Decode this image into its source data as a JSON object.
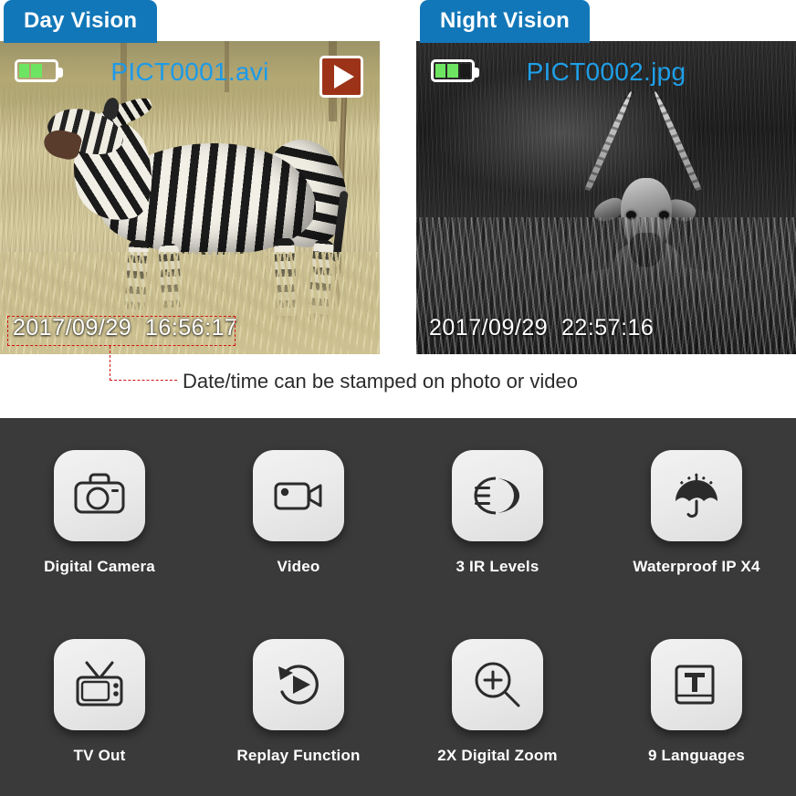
{
  "panels": [
    {
      "tab_label": "Day Vision",
      "file_name": "PICT0001.avi",
      "timestamp": "2017/09/29  16:56:17",
      "battery_icon": "battery-icon",
      "play_icon": "play-icon",
      "subject": "zebra"
    },
    {
      "tab_label": "Night Vision",
      "file_name": "PICT0002.jpg",
      "timestamp": "2017/09/29  22:57:16",
      "battery_icon": "battery-icon",
      "subject": "antelope"
    }
  ],
  "annotation": {
    "caption": "Date/time can be stamped on photo or video",
    "line_color": "#d01414"
  },
  "features": [
    {
      "label": "Digital Camera",
      "icon": "camera-icon"
    },
    {
      "label": "Video",
      "icon": "video-camera-icon"
    },
    {
      "label": "3 IR Levels",
      "icon": "ir-beam-icon"
    },
    {
      "label": "Waterproof IP X4",
      "icon": "umbrella-rain-icon"
    },
    {
      "label": "TV Out",
      "icon": "television-icon"
    },
    {
      "label": "Replay Function",
      "icon": "replay-icon"
    },
    {
      "label": "2X Digital Zoom",
      "icon": "magnifier-plus-icon"
    },
    {
      "label": "9 Languages",
      "icon": "book-letter-t-icon"
    }
  ],
  "colors": {
    "tab_blue": "#1277b8",
    "file_name_blue": "#1c9ae8",
    "play_badge_red": "#9c3318",
    "battery_green": "#6de562",
    "panel_dark": "#3a3a3a",
    "tile_gray": "#ececec",
    "annotation_red": "#d01414"
  }
}
